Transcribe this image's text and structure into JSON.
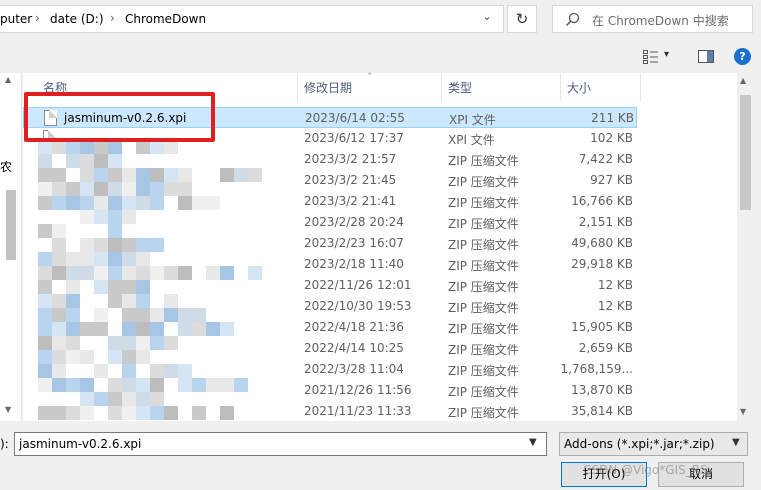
{
  "address_bar": {
    "crumbs": [
      "puter",
      "date (D:)",
      "ChromeDown"
    ],
    "separator": "›",
    "dropdown_glyph": "⌄",
    "refresh_glyph": "↻"
  },
  "search": {
    "placeholder": "在 ChromeDown 中搜索",
    "icon": "search-icon"
  },
  "toolbar": {
    "view_glyph": "▾",
    "help_label": "?"
  },
  "nav": {
    "fragment": "农"
  },
  "columns": {
    "name": "名称",
    "date": "修改日期",
    "type": "类型",
    "size": "大小"
  },
  "files": [
    {
      "name": "jasminum-v0.2.6.xpi",
      "date": "2023/6/14 02:55",
      "type": "XPI 文件",
      "size": "211 KB",
      "selected": true
    },
    {
      "name": "",
      "date": "2023/6/12 17:37",
      "type": "XPI 文件",
      "size": "102 KB"
    },
    {
      "name": "",
      "date": "2023/3/2 21:57",
      "type": "ZIP 压缩文件",
      "size": "7,422 KB"
    },
    {
      "name": "",
      "date": "2023/3/2 21:45",
      "type": "ZIP 压缩文件",
      "size": "927 KB"
    },
    {
      "name": "",
      "date": "2023/3/2 21:41",
      "type": "ZIP 压缩文件",
      "size": "16,766 KB"
    },
    {
      "name": "",
      "date": "2023/2/28 20:24",
      "type": "ZIP 压缩文件",
      "size": "2,151 KB"
    },
    {
      "name": "",
      "date": "2023/2/23 16:07",
      "type": "ZIP 压缩文件",
      "size": "49,680 KB"
    },
    {
      "name": "",
      "date": "2023/2/18 11:40",
      "type": "ZIP 压缩文件",
      "size": "29,918 KB"
    },
    {
      "name": "",
      "date": "2022/11/26 12:01",
      "type": "ZIP 压缩文件",
      "size": "12 KB"
    },
    {
      "name": "",
      "date": "2022/10/30 19:53",
      "type": "ZIP 压缩文件",
      "size": "12 KB"
    },
    {
      "name": "",
      "date": "2022/4/18 21:36",
      "type": "ZIP 压缩文件",
      "size": "15,905 KB"
    },
    {
      "name": "",
      "date": "2022/4/14 10:25",
      "type": "ZIP 压缩文件",
      "size": "2,659 KB"
    },
    {
      "name": "",
      "date": "2022/3/28 11:04",
      "type": "ZIP 压缩文件",
      "size": "1,768,159..."
    },
    {
      "name": "",
      "date": "2021/12/26 11:56",
      "type": "ZIP 压缩文件",
      "size": "13,870 KB"
    },
    {
      "name": "",
      "date": "2021/11/23 11:33",
      "type": "ZIP 压缩文件",
      "size": "35,814 KB"
    }
  ],
  "filename": {
    "label": "):",
    "value": "jasminum-v0.2.6.xpi"
  },
  "filetype": {
    "value": "Add-ons (*.xpi;*.jar;*.zip)"
  },
  "buttons": {
    "open": "打开(O)",
    "cancel": "取消"
  },
  "watermark": "CSDN @Vigo*GIS_RS",
  "colors": {
    "selection": "#cce8ff",
    "highlight_box": "#e02020",
    "header_text": "#4c607a",
    "default_button_border": "#0078d7"
  }
}
